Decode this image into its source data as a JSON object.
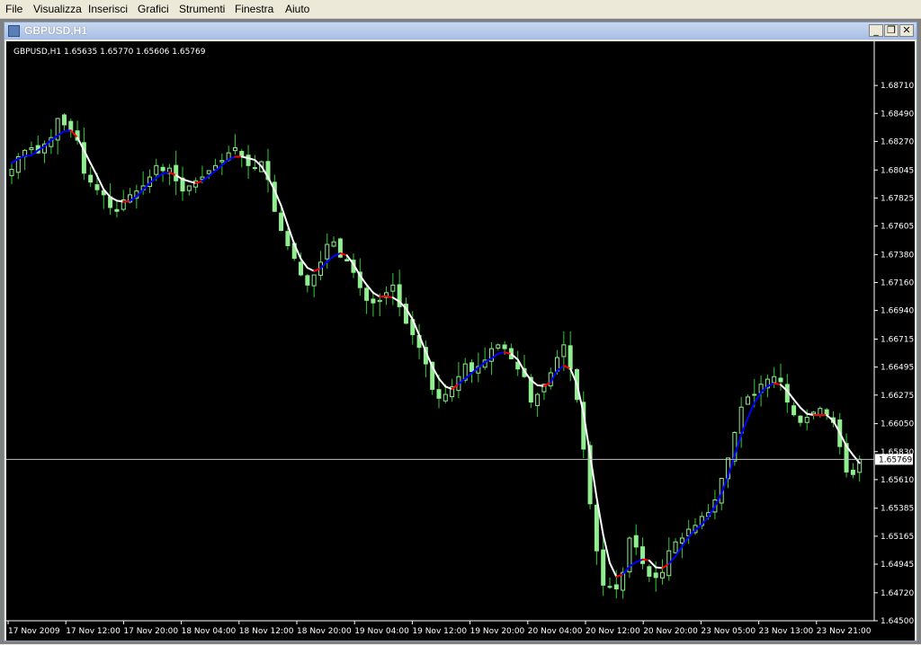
{
  "menu": [
    "File",
    "Visualizza",
    "Inserisci",
    "Grafici",
    "Strumenti",
    "Finestra",
    "Aiuto"
  ],
  "window": {
    "title": "GBPUSD,H1",
    "buttons": {
      "minimize": "_",
      "restore": "❐",
      "close": "✕"
    }
  },
  "chart_data": {
    "type": "candlestick",
    "symbol_info": "GBPUSD,H1  1.65635 1.65770 1.65606 1.65769",
    "current_price": "1.65769",
    "ylim": [
      1.645,
      1.6893
    ],
    "y_ticks": [
      "1.68710",
      "1.68490",
      "1.68270",
      "1.68045",
      "1.67825",
      "1.67605",
      "1.67380",
      "1.67160",
      "1.66940",
      "1.66715",
      "1.66495",
      "1.66275",
      "1.66050",
      "1.65830",
      "1.65610",
      "1.65385",
      "1.65165",
      "1.64945",
      "1.64720",
      "1.64500"
    ],
    "x_ticks": [
      "17 Nov 2009",
      "17 Nov 12:00",
      "17 Nov 20:00",
      "18 Nov 04:00",
      "18 Nov 12:00",
      "18 Nov 20:00",
      "19 Nov 04:00",
      "19 Nov 12:00",
      "19 Nov 20:00",
      "20 Nov 04:00",
      "20 Nov 12:00",
      "20 Nov 20:00",
      "23 Nov 05:00",
      "23 Nov 13:00",
      "23 Nov 21:00"
    ],
    "colors": {
      "background": "#000000",
      "candle": "#90ee90",
      "wick": "#32cd32",
      "ma_up": "#ffffff",
      "ma_down": "#0000ff",
      "turn": "#ff0000",
      "axis_text": "#ffffff",
      "price_line": "#c0c0c0"
    },
    "closes": [
      1.6805,
      1.6815,
      1.682,
      1.6822,
      1.6818,
      1.6825,
      1.683,
      1.6845,
      1.684,
      1.6835,
      1.6828,
      1.6802,
      1.6795,
      1.6789,
      1.6785,
      1.6775,
      1.6772,
      1.6781,
      1.6785,
      1.6788,
      1.6792,
      1.6799,
      1.6808,
      1.6804,
      1.6806,
      1.6796,
      1.6788,
      1.6792,
      1.6796,
      1.6799,
      1.6804,
      1.6808,
      1.6812,
      1.6818,
      1.6822,
      1.6815,
      1.6808,
      1.6806,
      1.6811,
      1.6797,
      1.6772,
      1.6757,
      1.6745,
      1.6735,
      1.6722,
      1.6714,
      1.6722,
      1.6732,
      1.6746,
      1.6748,
      1.6736,
      1.6733,
      1.6724,
      1.6712,
      1.6702,
      1.67,
      1.6702,
      1.6708,
      1.6714,
      1.6697,
      1.6684,
      1.6675,
      1.6665,
      1.6652,
      1.6632,
      1.6625,
      1.6628,
      1.6634,
      1.6642,
      1.6652,
      1.6646,
      1.665,
      1.6655,
      1.6664,
      1.6667,
      1.6664,
      1.6656,
      1.6648,
      1.6642,
      1.6622,
      1.6628,
      1.6636,
      1.6645,
      1.6657,
      1.6667,
      1.6648,
      1.6624,
      1.6585,
      1.6542,
      1.6505,
      1.6478,
      1.6477,
      1.6475,
      1.6488,
      1.6515,
      1.6508,
      1.6495,
      1.6485,
      1.6484,
      1.6488,
      1.6505,
      1.6512,
      1.6515,
      1.6522,
      1.6525,
      1.6532,
      1.6535,
      1.6545,
      1.6562,
      1.6578,
      1.6598,
      1.6618,
      1.6626,
      1.6628,
      1.6636,
      1.664,
      1.6642,
      1.6638,
      1.6622,
      1.6612,
      1.6606,
      1.661,
      1.6614,
      1.6617,
      1.6612,
      1.6606,
      1.6587,
      1.6567,
      1.6565,
      1.6577
    ]
  }
}
